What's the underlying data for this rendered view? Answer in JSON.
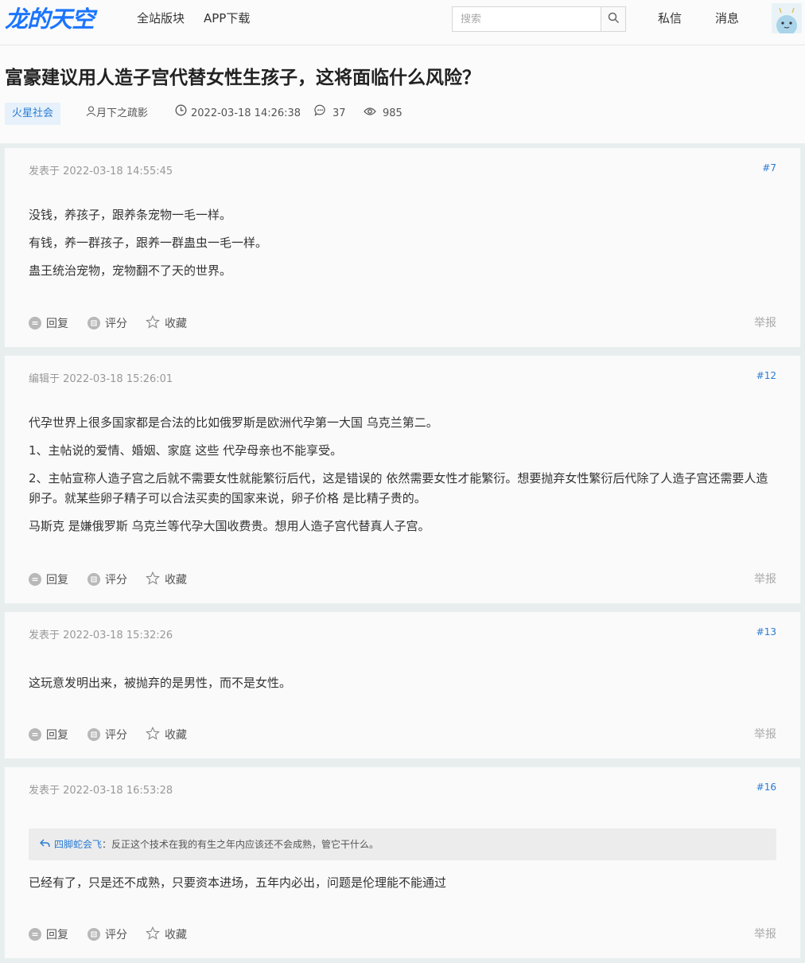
{
  "header": {
    "logo": "龙的天空",
    "nav": [
      "全站版块",
      "APP下载"
    ],
    "search_placeholder": "搜索",
    "messages_private": "私信",
    "messages_notice": "消息",
    "icons": {
      "search": "search-icon",
      "avatar": "avatar"
    }
  },
  "thread": {
    "title": "富豪建议用人造子宫代替女性生孩子，这将面临什么风险？",
    "tag": "火星社会",
    "author": "月下之疏影",
    "time": "2022-03-18 14:26:38",
    "comments": "37",
    "views": "985"
  },
  "actions": {
    "reply": "回复",
    "rate": "评分",
    "favorite": "收藏",
    "report": "举报"
  },
  "posts": [
    {
      "time_label": "发表于 2022-03-18 14:55:45",
      "floor": "#7",
      "paragraphs": [
        "没钱，养孩子，跟养条宠物一毛一样。",
        "有钱，养一群孩子，跟养一群蛊虫一毛一样。",
        "蛊王统治宠物，宠物翻不了天的世界。"
      ]
    },
    {
      "time_label": "编辑于 2022-03-18 15:26:01",
      "floor": "#12",
      "paragraphs": [
        "代孕世界上很多国家都是合法的比如俄罗斯是欧洲代孕第一大国 乌克兰第二。",
        "1、主帖说的爱情、婚姻、家庭 这些 代孕母亲也不能享受。",
        "2、主帖宣称人造子宫之后就不需要女性就能繁衍后代，这是错误的 依然需要女性才能繁衍。想要抛弃女性繁衍后代除了人造子宫还需要人造卵子。就某些卵子精子可以合法买卖的国家来说，卵子价格 是比精子贵的。",
        "马斯克 是嫌俄罗斯 乌克兰等代孕大国收费贵。想用人造子宫代替真人子宫。"
      ]
    },
    {
      "time_label": "发表于 2022-03-18 15:32:26",
      "floor": "#13",
      "paragraphs": [
        "这玩意发明出来，被抛弃的是男性，而不是女性。"
      ]
    },
    {
      "time_label": "发表于 2022-03-18 16:53:28",
      "floor": "#16",
      "quote": {
        "user": "四脚蛇会飞",
        "text": "：反正这个技术在我的有生之年内应该还不会成熟，管它干什么。"
      },
      "paragraphs": [
        "已经有了，只是还不成熟，只要资本进场，五年内必出，问题是伦理能不能通过"
      ]
    }
  ]
}
